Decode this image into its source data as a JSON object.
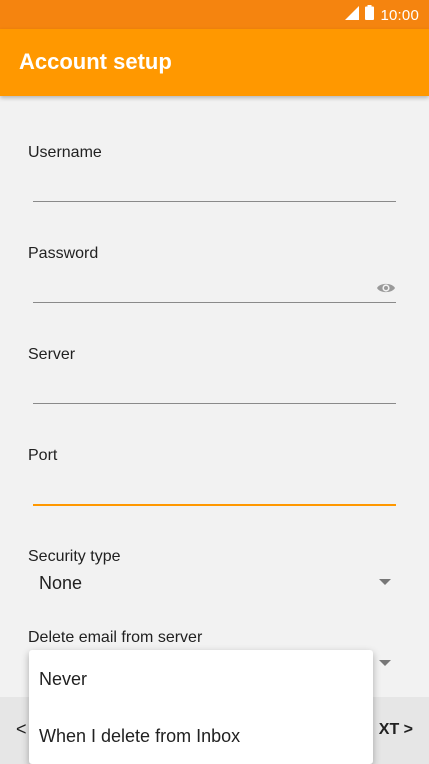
{
  "status_bar": {
    "time": "10:00"
  },
  "app_bar": {
    "title": "Account setup"
  },
  "form": {
    "username": {
      "label": "Username",
      "value": ""
    },
    "password": {
      "label": "Password",
      "value": ""
    },
    "server": {
      "label": "Server",
      "value": ""
    },
    "port": {
      "label": "Port",
      "value": ""
    },
    "security_type": {
      "label": "Security type",
      "value": "None"
    },
    "delete_email": {
      "label": "Delete email from server"
    }
  },
  "popup_menu": {
    "items": [
      "Never",
      "When I delete from Inbox"
    ]
  },
  "bottom_bar": {
    "back_label": "<",
    "next_label": "XT >"
  },
  "colors": {
    "accent": "#ff9800",
    "status_bar": "#f5840f"
  }
}
